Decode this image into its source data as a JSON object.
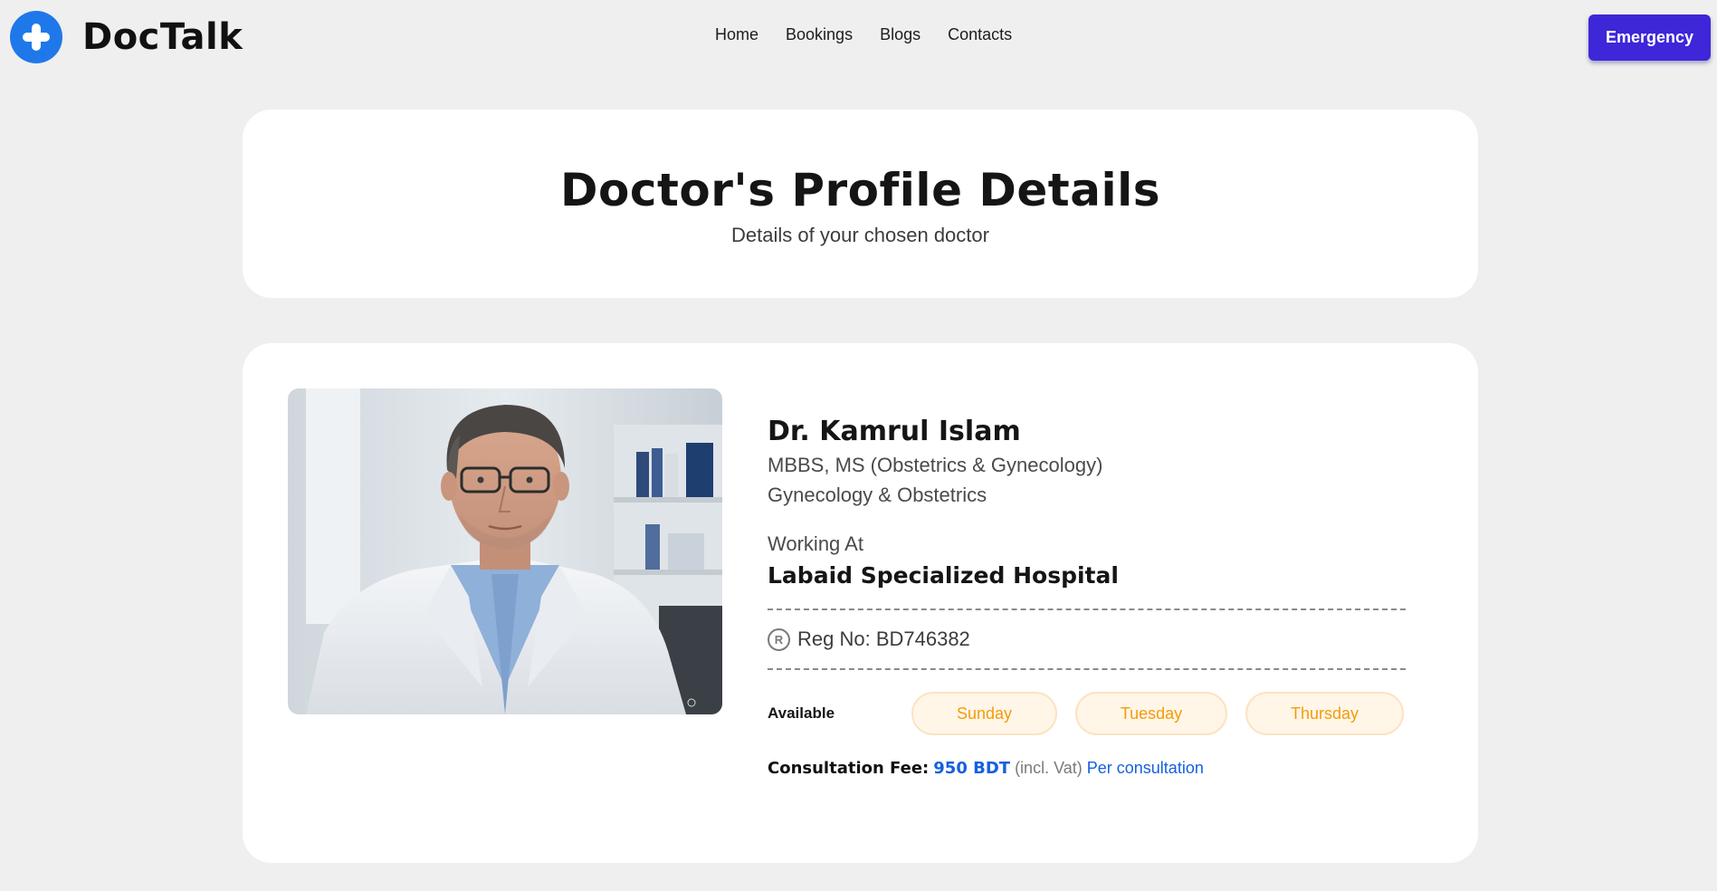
{
  "header": {
    "brand": "DocTalk",
    "nav": [
      "Home",
      "Bookings",
      "Blogs",
      "Contacts"
    ],
    "emergency_label": "Emergency",
    "accent_color": "#3d27d8",
    "logo_color": "#1f78ea"
  },
  "title_card": {
    "title": "Doctor's Profile Details",
    "subtitle": "Details of your chosen doctor"
  },
  "doctor": {
    "name": "Dr. Kamrul Islam",
    "degree": "MBBS, MS (Obstetrics & Gynecology)",
    "specialty": "Gynecology & Obstetrics",
    "working_label": "Working At",
    "hospital": "Labaid Specialized Hospital",
    "reg_icon": "registered-icon",
    "reg": "Reg No: BD746382",
    "available_label": "Available",
    "days": [
      "Sunday",
      "Tuesday",
      "Thursday"
    ],
    "fee_label": "Consultation Fee:",
    "fee_amount": "950 BDT",
    "fee_vat": "(incl. Vat)",
    "fee_per": "Per consultation"
  }
}
